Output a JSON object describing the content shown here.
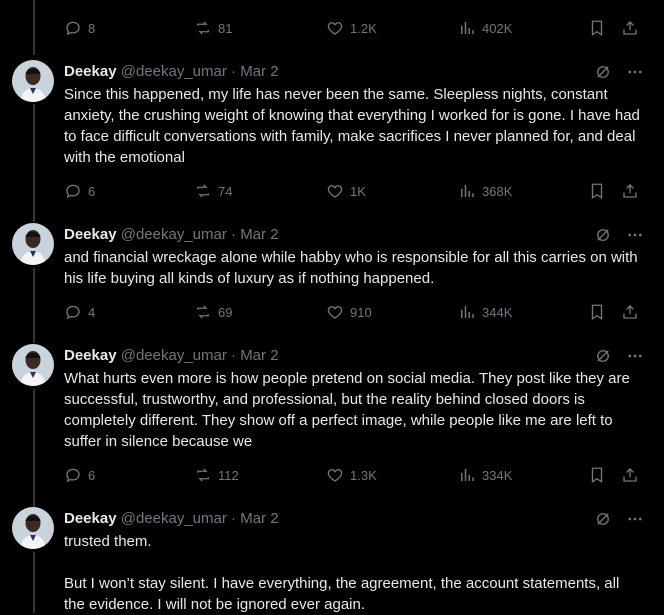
{
  "top": {
    "partial_text": "",
    "replies": "8",
    "reposts": "81",
    "likes": "1.2K",
    "views": "402K"
  },
  "tweets": [
    {
      "name": "Deekay",
      "handle": "@deekay_umar",
      "sep": "·",
      "date": "Mar 2",
      "text": "Since this happened, my life has never been the same. Sleepless nights, constant anxiety, the crushing weight of knowing that everything I worked for is gone. I have had to face difficult conversations with family, make sacrifices I never planned for, and deal with the emotional",
      "replies": "6",
      "reposts": "74",
      "likes": "1K",
      "views": "368K"
    },
    {
      "name": "Deekay",
      "handle": "@deekay_umar",
      "sep": "·",
      "date": "Mar 2",
      "text": "and financial wreckage alone while habby who is responsible for all this carries on with his life buying all kinds of luxury as if nothing happened.",
      "replies": "4",
      "reposts": "69",
      "likes": "910",
      "views": "344K"
    },
    {
      "name": "Deekay",
      "handle": "@deekay_umar",
      "sep": "·",
      "date": "Mar 2",
      "text": "What hurts even more is how people pretend on social media. They post like they are successful, trustworthy, and professional, but the reality behind closed doors is completely different. They show off a perfect image, while people like me are left to suffer in silence because we",
      "replies": "6",
      "reposts": "112",
      "likes": "1.3K",
      "views": "334K"
    },
    {
      "name": "Deekay",
      "handle": "@deekay_umar",
      "sep": "·",
      "date": "Mar 2",
      "text": "trusted them.\n\nBut I won’t stay silent. I have everything, the agreement, the account statements, all the evidence. I will not be ignored ever again."
    }
  ],
  "icons": {
    "reply": "reply-icon",
    "repost": "repost-icon",
    "like": "heart-icon",
    "views": "views-icon",
    "bookmark": "bookmark-icon",
    "share": "share-icon",
    "grok": "grok-icon",
    "more": "more-icon"
  },
  "colors": {
    "background": "#000000",
    "text": "#e7e9ea",
    "muted": "#71767b",
    "thread_line": "#333639"
  }
}
